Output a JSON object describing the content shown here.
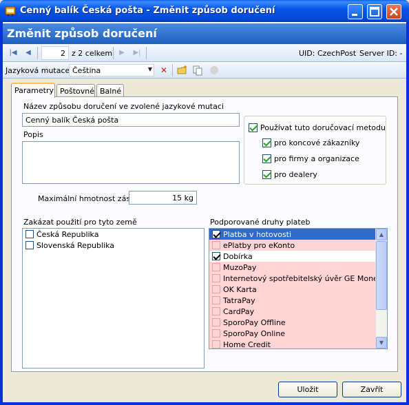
{
  "window": {
    "title": "Cenný balík Česká pošta - Změnit způsob doručení"
  },
  "header": {
    "title": "Změnit způsob doručení"
  },
  "navigation": {
    "page_value": "2",
    "page_total": "z 2 celkem",
    "uid": "UID: CzechPost",
    "server": "Server ID: -"
  },
  "language": {
    "label": "Jazyková mutace",
    "selected": "Čeština"
  },
  "tabs": [
    "Parametry",
    "Poštovné",
    "Balné"
  ],
  "form": {
    "name_label": "Název způsobu doručení ve zvolené jazykové mutaci",
    "name_value": "Cenný balík Česká pošta",
    "description_label": "Popis",
    "description_value": "",
    "use_method_label": "Používat tuto doručovací metodu",
    "use_method_checked": true,
    "audience": [
      {
        "label": "pro koncové zákazníky",
        "checked": true
      },
      {
        "label": "pro firmy a organizace",
        "checked": true
      },
      {
        "label": "pro dealery",
        "checked": true
      }
    ],
    "max_weight_label": "Maximální hmotnost zásilky",
    "max_weight_value": "15 kg",
    "forbidden_countries_label": "Zakázat použití pro tyto země",
    "countries": [
      {
        "label": "Česká Republika",
        "checked": false
      },
      {
        "label": "Slovenská Republika",
        "checked": false
      }
    ],
    "payments_label": "Podporované druhy plateb",
    "payments": [
      {
        "label": "Platba v hotovosti",
        "checked": true,
        "state": "selected"
      },
      {
        "label": "ePlatby pro eKonto",
        "checked": false,
        "state": "pink"
      },
      {
        "label": "Dobírka",
        "checked": true,
        "state": "white"
      },
      {
        "label": "MuzoPay",
        "checked": false,
        "state": "pink"
      },
      {
        "label": "Internetový spotřebitelský úvěr GE Money Ba",
        "checked": false,
        "state": "pink"
      },
      {
        "label": "OK Karta",
        "checked": false,
        "state": "pink"
      },
      {
        "label": "TatraPay",
        "checked": false,
        "state": "pink"
      },
      {
        "label": "CardPay",
        "checked": false,
        "state": "pink"
      },
      {
        "label": "SporoPay Offline",
        "checked": false,
        "state": "pink"
      },
      {
        "label": "SporoPay Online",
        "checked": false,
        "state": "pink"
      },
      {
        "label": "Home Credit",
        "checked": false,
        "state": "pink"
      }
    ]
  },
  "footer": {
    "save_label": "Uložit",
    "close_label": "Zavřít"
  },
  "colors": {
    "title_bar": "#0054e3",
    "header_band": "#2a6bd0",
    "selected_row": "#316ac5",
    "disabled_row": "#ffd4d4"
  },
  "icons": [
    "cart-icon",
    "minimize-icon",
    "maximize-icon",
    "close-icon",
    "first-page-icon",
    "prev-page-icon",
    "next-page-icon",
    "last-page-icon",
    "dropdown-arrow-icon",
    "delete-icon",
    "new-folder-icon",
    "copy-icon",
    "disabled-circle-icon"
  ]
}
